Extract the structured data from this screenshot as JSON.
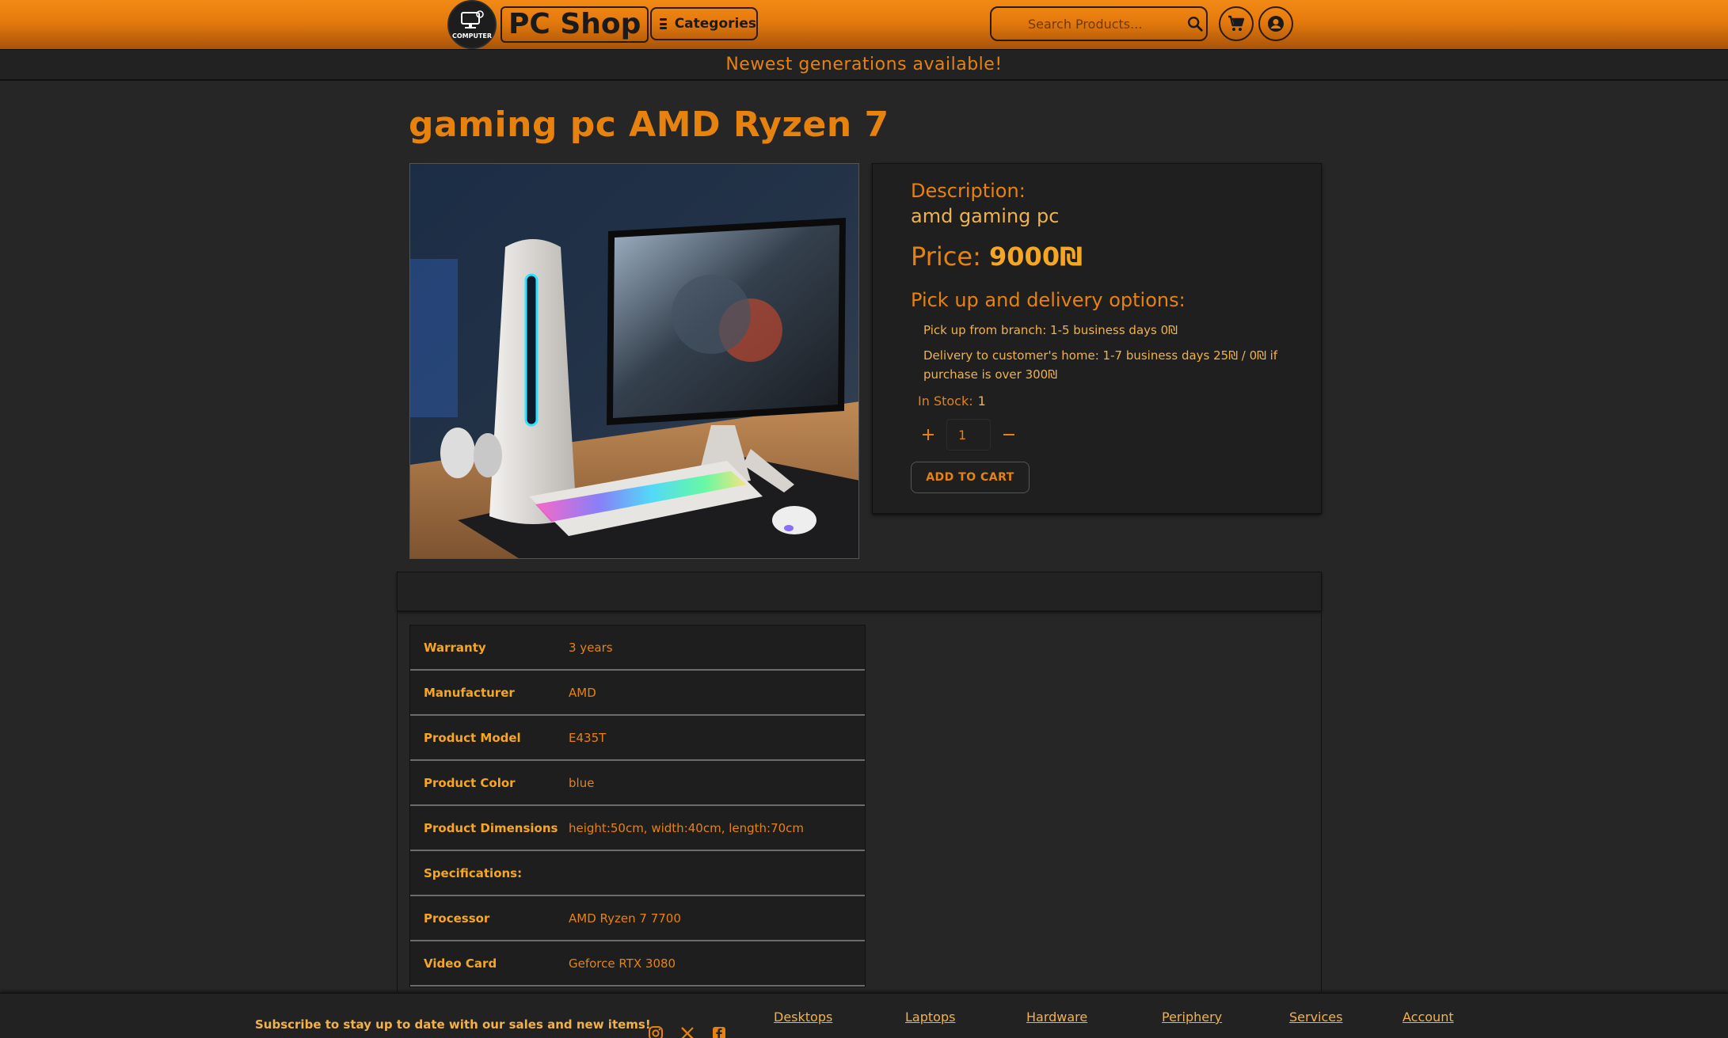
{
  "header": {
    "logo_text": "COMPUTER",
    "brand": "PC Shop",
    "categories_label": "Categories",
    "search_placeholder": "Search Products..."
  },
  "banner": "Newest generations available!",
  "product": {
    "title": "gaming pc AMD Ryzen 7",
    "description_label": "Description:",
    "description": "amd gaming pc",
    "price_label": "Price:",
    "price_value": "9000₪",
    "delivery_title": "Pick up and delivery options:",
    "delivery_options": [
      "Pick up from branch: 1-5 business days 0₪",
      "Delivery to customer's home: 1-7 business days 25₪ / 0₪ if purchase is over 300₪"
    ],
    "stock_label": "In Stock:",
    "stock_value": "1",
    "quantity": "1",
    "add_to_cart": "ADD TO CART"
  },
  "specs": [
    {
      "key": "Warranty",
      "value": "3 years"
    },
    {
      "key": "Manufacturer",
      "value": "AMD"
    },
    {
      "key": "Product Model",
      "value": "E435T"
    },
    {
      "key": "Product Color",
      "value": "blue"
    },
    {
      "key": "Product Dimensions",
      "value": "height:50cm, width:40cm, length:70cm"
    },
    {
      "key": "Specifications:",
      "value": ""
    },
    {
      "key": "Processor",
      "value": "AMD Ryzen 7 7700"
    },
    {
      "key": "Video Card",
      "value": "Geforce RTX 3080"
    }
  ],
  "footer": {
    "subscribe": "Subscribe to stay up to date with our sales and new items!",
    "links": [
      "Desktops",
      "Laptops",
      "Hardware",
      "Periphery",
      "Services",
      "Account"
    ]
  },
  "colors": {
    "accent": "#e8820e",
    "accent_light": "#f0b24d",
    "background": "#262626",
    "header_orange": "#f28a16"
  }
}
